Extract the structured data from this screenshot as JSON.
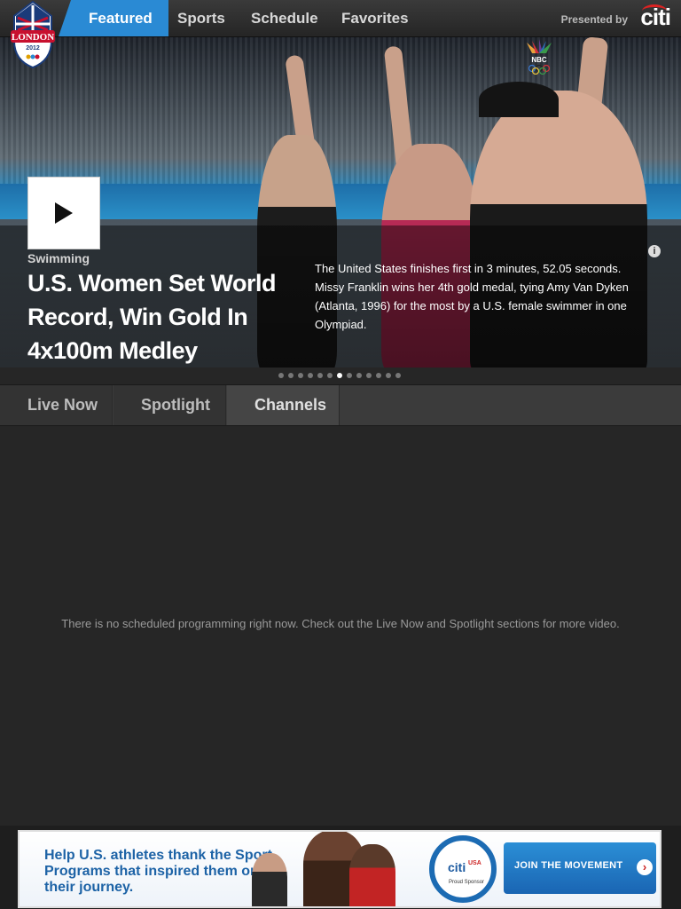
{
  "nav": {
    "tabs": [
      {
        "label": "Featured",
        "selected": true
      },
      {
        "label": "Sports",
        "selected": false
      },
      {
        "label": "Schedule",
        "selected": false
      },
      {
        "label": "Favorites",
        "selected": false
      }
    ],
    "presented_by": "Presented by",
    "sponsor": "citi",
    "accent_color": "#2a8ad4"
  },
  "logo": {
    "text": "LONDON",
    "year": "2012"
  },
  "hero": {
    "category": "Swimming",
    "headline": "U.S. Women Set World Record, Win Gold In 4x100m Medley",
    "description": "The United States finishes first in 3 minutes, 52.05 seconds. Missy Franklin wins her 4th gold medal, tying Amy Van Dyken (Atlanta, 1996) for the most by a U.S. female swimmer in one Olympiad.",
    "network_icon": "nbc-peacock-icon",
    "info_icon": "i",
    "pager": {
      "total": 13,
      "current": 7
    }
  },
  "sections": {
    "tabs": [
      {
        "label": "Live Now",
        "selected": false
      },
      {
        "label": "Spotlight",
        "selected": false
      },
      {
        "label": "Channels",
        "selected": true
      }
    ],
    "empty_message": "There is no scheduled programming right now. Check out the Live Now and Spotlight sections for more video."
  },
  "ad": {
    "headline": "Help U.S. athletes thank the Sport Programs that inspired them on their journey.",
    "badge_brand": "citi",
    "badge_partner": "USA",
    "badge_sub": "Proud Sponsor",
    "cta": "JOIN THE MOVEMENT",
    "cta_arrow": "›"
  }
}
